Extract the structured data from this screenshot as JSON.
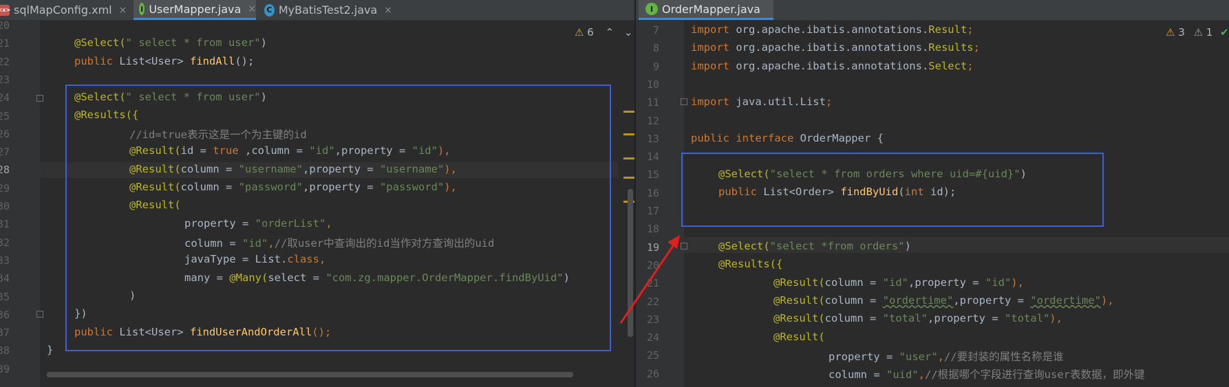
{
  "left": {
    "tabs": [
      {
        "icon": "xml-file-icon",
        "icon_text": "<x>",
        "label": "sqlMapConfig.xml",
        "close": "×",
        "active": false
      },
      {
        "icon": "interface-icon",
        "icon_text": "I",
        "label": "UserMapper.java",
        "close": "×",
        "active": true
      },
      {
        "icon": "class-icon",
        "icon_text": "C",
        "label": "MyBatisTest2.java",
        "close": "×",
        "active": false
      }
    ],
    "warnings": "6",
    "line_numbers": [
      "20",
      "21",
      "22",
      "23",
      "24",
      "25",
      "26",
      "27",
      "28",
      "29",
      "30",
      "31",
      "32",
      "33",
      "34",
      "35",
      "36",
      "37",
      "38",
      "39"
    ],
    "current_line": "28"
  },
  "right": {
    "tabs": [
      {
        "icon": "interface-icon",
        "icon_text": "I",
        "label": "OrderMapper.java",
        "active": true
      }
    ],
    "warnings": "3",
    "weak_warnings": "1",
    "line_numbers": [
      "7",
      "8",
      "9",
      "10",
      "11",
      "12",
      "13",
      "14",
      "15",
      "16",
      "17",
      "18",
      "19",
      "20",
      "21",
      "22",
      "23",
      "24",
      "25",
      "26"
    ],
    "current_line": "19"
  },
  "code_left": {
    "l21a": "@Select(",
    "l21b": "\" select * from user\"",
    "l21c": ")",
    "l22a": "public ",
    "l22b": "List<User> ",
    "l22c": "findAll",
    "l22d": "();",
    "l24a": "@Select(",
    "l24b": "\" select * from user\"",
    "l24c": ")",
    "l25a": "@Results({",
    "l26a": "//id=true表示这是一个为主键的id",
    "l27a": "@Result(",
    "l27b": "id = ",
    "l27c": "true ",
    "l27d": ",column = ",
    "l27e": "\"id\"",
    "l27f": ",property = ",
    "l27g": "\"id\"",
    "l27h": "),",
    "l28a": "@Result(",
    "l28b": "column = ",
    "l28c": "\"username\"",
    "l28d": ",property = ",
    "l28e": "\"username\"",
    "l28f": "),",
    "l29a": "@Result(",
    "l29b": "column = ",
    "l29c": "\"password\"",
    "l29d": ",property = ",
    "l29e": "\"password\"",
    "l29f": "),",
    "l30a": "@Result(",
    "l31a": "property = ",
    "l31b": "\"orderList\"",
    "l31c": ",",
    "l32a": "column = ",
    "l32b": "\"id\"",
    "l32c": ",",
    "l32d": "//取user中查询出的id当作对方查询出的uid",
    "l33a": "javaType = List.",
    "l33b": "class",
    "l33c": ",",
    "l34a": "many = ",
    "l34b": "@Many(",
    "l34c": "select = ",
    "l34d": "\"com.zg.mapper.OrderMapper.findByUid\"",
    "l34e": ")",
    "l35a": ")",
    "l36a": "})",
    "l37a": "public ",
    "l37b": "List<User> ",
    "l37c": "findUserAndOrderAll",
    "l37d": "();",
    "l38a": "}"
  },
  "code_right": {
    "r7a": "import ",
    "r7b": "org.apache.ibatis.annotations.",
    "r7c": "Result",
    "r7d": ";",
    "r8a": "import ",
    "r8b": "org.apache.ibatis.annotations.",
    "r8c": "Results",
    "r8d": ";",
    "r9a": "import ",
    "r9b": "org.apache.ibatis.annotations.",
    "r9c": "Select",
    "r9d": ";",
    "r11a": "import ",
    "r11b": "java.util.List",
    "r11c": ";",
    "r13a": "public interface ",
    "r13b": "OrderMapper {",
    "r15a": "@Select(",
    "r15b": "\"select * from orders where uid=#{uid}\"",
    "r15c": ")",
    "r16a": "public ",
    "r16b": "List<Order> ",
    "r16c": "findByUid",
    "r16d": "(",
    "r16e": "int ",
    "r16f": "id);",
    "r19a": "@Select(",
    "r19b": "\"select *from orders\"",
    "r19c": ")",
    "r20a": "@Results({",
    "r21a": "@Result(",
    "r21b": "column = ",
    "r21c": "\"id\"",
    "r21d": ",property = ",
    "r21e": "\"id\"",
    "r21f": "),",
    "r22a": "@Result(",
    "r22b": "column = ",
    "r22c": "\"ordertime\"",
    "r22d": ",property = ",
    "r22e": "\"ordertime\"",
    "r22f": "),",
    "r23a": "@Result(",
    "r23b": "column = ",
    "r23c": "\"total\"",
    "r23d": ",property = ",
    "r23e": "\"total\"",
    "r23f": "),",
    "r24a": "@Result(",
    "r25a": "property = ",
    "r25b": "\"user\"",
    "r25c": ",",
    "r25d": "//要封装的属性名称是谁",
    "r26a": "column = ",
    "r26b": "\"uid\"",
    "r26c": ",",
    "r26d": "//根据哪个字段进行查询user表数据，即外键"
  },
  "colors": {
    "annotation": "#bbb529",
    "string": "#6a8759",
    "keyword": "#cc7832",
    "method": "#ffc66d",
    "comment": "#808080",
    "highlight_box": "#3d5ee0",
    "arrow": "#e02020"
  }
}
